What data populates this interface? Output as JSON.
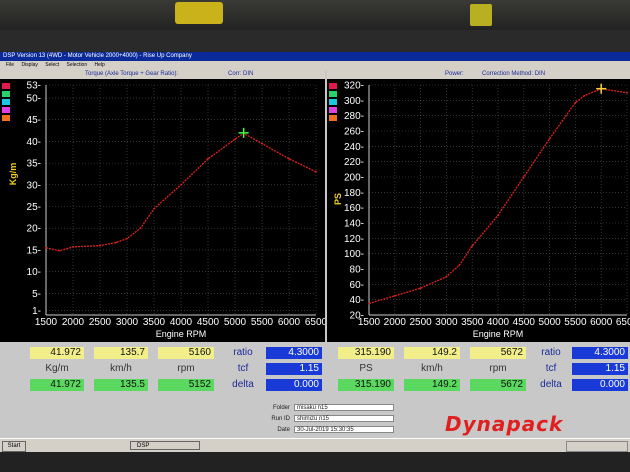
{
  "window": {
    "title": "DSP Version 13 (4WD - Motor Vehicle 2000+4000) - Rise Up Company",
    "menu": [
      "File",
      "Display",
      "Select",
      "Selection",
      "Help"
    ]
  },
  "left_header": {
    "title": "Torque (Axle Torque + Gear Ratio):",
    "corr": "Corr: DIN"
  },
  "right_header": {
    "title": "Power:",
    "corr": "Correction Method: DIN"
  },
  "legend_colors": [
    "#e01a4a",
    "#2ad06a",
    "#1ac8e0",
    "#e040e0",
    "#f07020"
  ],
  "chart_data": [
    {
      "type": "line",
      "xlabel": "Engine RPM",
      "ylabel": "Kg/m",
      "xlim": [
        1500,
        6500
      ],
      "ylim": [
        0,
        53
      ],
      "x_ticks": [
        "1500",
        "2000",
        "2500",
        "3000",
        "3500",
        "4000",
        "4500",
        "5000",
        "5500",
        "6000",
        "6500"
      ],
      "y_ticks": [
        "1",
        "5",
        "10",
        "15",
        "20",
        "25",
        "30",
        "35",
        "40",
        "45",
        "50",
        "53"
      ],
      "series": [
        {
          "color": "#e02020",
          "x": [
            1500,
            1750,
            2000,
            2500,
            2800,
            3000,
            3250,
            3500,
            4000,
            4500,
            5000,
            5160,
            5500,
            6000,
            6500
          ],
          "y": [
            15.5,
            14.8,
            15.7,
            16.0,
            16.7,
            17.6,
            20.0,
            24.5,
            30.0,
            36.0,
            40.5,
            41.9,
            39.5,
            36.0,
            33.0
          ]
        }
      ],
      "marker": {
        "x": 5160,
        "y": 41.972,
        "color": "#40ff40"
      }
    },
    {
      "type": "line",
      "xlabel": "Engine RPM",
      "ylabel": "PS",
      "xlim": [
        1500,
        6500
      ],
      "ylim": [
        20,
        320
      ],
      "x_ticks": [
        "1500",
        "2000",
        "2500",
        "3000",
        "3500",
        "4000",
        "4500",
        "5000",
        "5500",
        "6000",
        "6500"
      ],
      "y_ticks": [
        "20",
        "40",
        "60",
        "80",
        "100",
        "120",
        "140",
        "160",
        "180",
        "200",
        "220",
        "240",
        "260",
        "280",
        "300",
        "320"
      ],
      "series": [
        {
          "color": "#e02020",
          "x": [
            1500,
            2000,
            2500,
            3000,
            3250,
            3500,
            4000,
            4500,
            5000,
            5500,
            5672,
            6000,
            6500
          ],
          "y": [
            35,
            45,
            55,
            70,
            85,
            110,
            150,
            200,
            250,
            297,
            306,
            315,
            310
          ]
        }
      ],
      "marker": {
        "x": 6000,
        "y": 315.19,
        "color": "#ffd040"
      }
    }
  ],
  "left_values": {
    "row1": [
      "41.972",
      "135.7",
      "5160"
    ],
    "units": [
      "Kg/m",
      "km/h",
      "rpm"
    ],
    "row2": [
      "41.972",
      "135.5",
      "5152"
    ],
    "ratio_label": "ratio",
    "ratio": "4.3000",
    "tcf_label": "tcf",
    "tcf": "1.15",
    "delta_label": "delta",
    "delta": "0.000"
  },
  "right_values": {
    "row1": [
      "315.190",
      "149.2",
      "5672"
    ],
    "units": [
      "PS",
      "km/h",
      "rpm"
    ],
    "row2": [
      "315.190",
      "149.2",
      "5672"
    ],
    "ratio_label": "ratio",
    "ratio": "4.3000",
    "tcf_label": "tcf",
    "tcf": "1.15",
    "delta_label": "delta",
    "delta": "0.000"
  },
  "info": {
    "folder_label": "Folder",
    "folder": "misaku n15",
    "runid_label": "Run ID",
    "runid": "shimizu n15",
    "date_label": "Date",
    "date": "30-Jul-2019 15:30:35"
  },
  "logo": "Dynapack",
  "taskbar": {
    "start": "Start",
    "task": "DSP"
  }
}
